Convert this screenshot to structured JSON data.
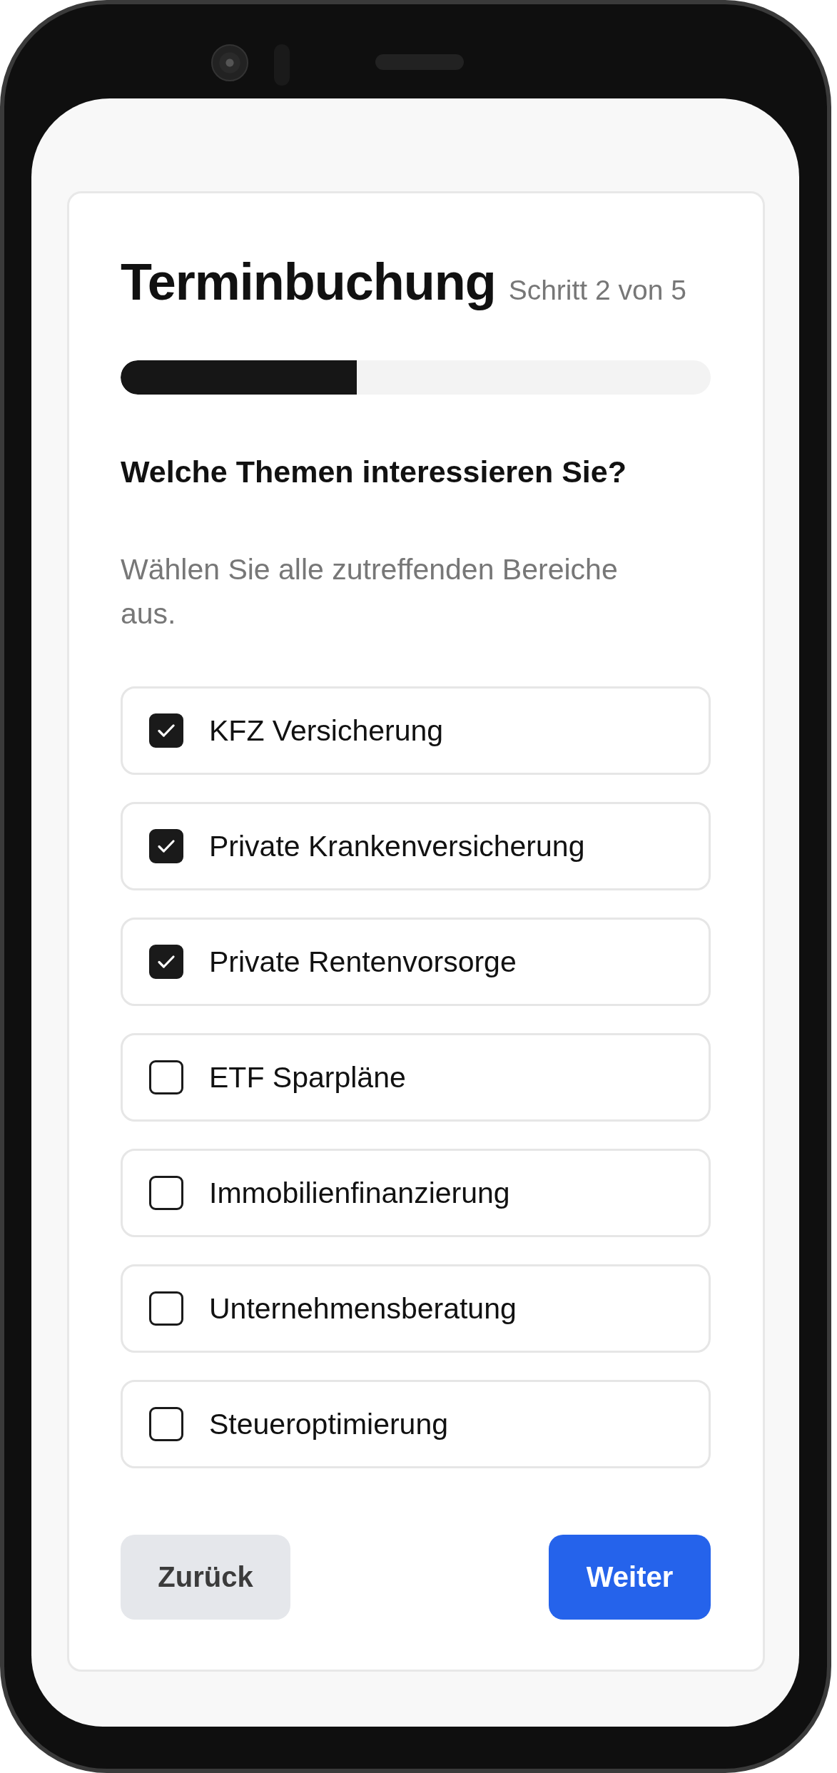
{
  "header": {
    "title": "Terminbuchung",
    "step": "Schritt 2 von 5"
  },
  "progress": {
    "level": 0.4
  },
  "question": "Welche Themen interessieren Sie?",
  "hint": "Wählen Sie alle zutreffenden Bereiche aus.",
  "options": [
    {
      "label": "KFZ Versicherung",
      "checked": true
    },
    {
      "label": "Private Krankenversicherung",
      "checked": true
    },
    {
      "label": "Private Rentenvorsorge",
      "checked": true
    },
    {
      "label": "ETF Sparpläne",
      "checked": false
    },
    {
      "label": "Immobilienfinanzierung",
      "checked": false
    },
    {
      "label": "Unternehmensberatung",
      "checked": false
    },
    {
      "label": "Steueroptimierung",
      "checked": false
    }
  ],
  "buttons": [
    {
      "label": "Zurück",
      "kind": "secondary"
    },
    {
      "label": "Weiter",
      "kind": "primary"
    }
  ]
}
